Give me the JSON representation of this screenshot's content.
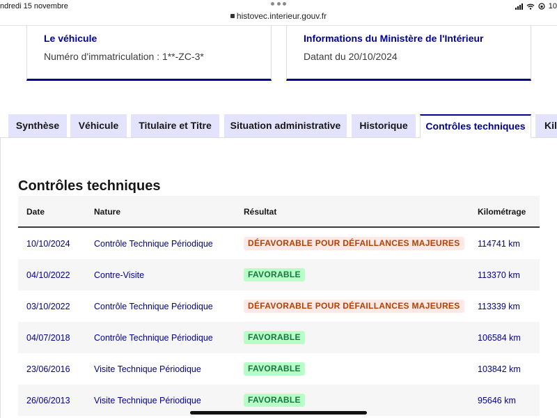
{
  "status_bar": {
    "date": "ndredi 15 novembre",
    "battery": "10"
  },
  "browser": {
    "url": "histovec.interieur.gouv.fr"
  },
  "cards": {
    "vehicle": {
      "title": "Le véhicule",
      "subtitle": "Numéro d'immatriculation : 1**-ZC-3*"
    },
    "ministry": {
      "title": "Informations du Ministère de l'Intérieur",
      "subtitle": "Datant du 20/10/2024"
    }
  },
  "tabs": [
    {
      "label": "Synthèse",
      "active": false
    },
    {
      "label": "Véhicule",
      "active": false
    },
    {
      "label": "Titulaire et Titre",
      "active": false
    },
    {
      "label": "Situation administrative",
      "active": false
    },
    {
      "label": "Historique",
      "active": false
    },
    {
      "label": "Contrôles techniques",
      "active": true
    },
    {
      "label": "Kil",
      "active": false
    }
  ],
  "section": {
    "title": "Contrôles techniques"
  },
  "table": {
    "headers": {
      "date": "Date",
      "nature": "Nature",
      "result": "Résultat",
      "mileage": "Kilométrage"
    },
    "rows": [
      {
        "date": "10/10/2024",
        "nature": "Contrôle Technique Périodique",
        "result": "DÉFAVORABLE POUR DÉFAILLANCES MAJEURES",
        "result_status": "fail",
        "mileage": "114741 km"
      },
      {
        "date": "04/10/2022",
        "nature": "Contre-Visite",
        "result": "FAVORABLE",
        "result_status": "ok",
        "mileage": "113370 km"
      },
      {
        "date": "03/10/2022",
        "nature": "Contrôle Technique Périodique",
        "result": "DÉFAVORABLE POUR DÉFAILLANCES MAJEURES",
        "result_status": "fail",
        "mileage": "113339 km"
      },
      {
        "date": "04/07/2018",
        "nature": "Contrôle Technique Périodique",
        "result": "FAVORABLE",
        "result_status": "ok",
        "mileage": "106584 km"
      },
      {
        "date": "23/06/2016",
        "nature": "Visite Technique Périodique",
        "result": "FAVORABLE",
        "result_status": "ok",
        "mileage": "103842 km"
      },
      {
        "date": "26/06/2013",
        "nature": "Visite Technique Périodique",
        "result": "FAVORABLE",
        "result_status": "ok",
        "mileage": "95646 km"
      }
    ]
  },
  "colors": {
    "primary_blue": "#000091",
    "tab_background": "#e3e3fd",
    "fail_text": "#b34000",
    "fail_background": "#ffe9e6",
    "ok_text": "#18753c",
    "ok_background": "#b8fec9"
  },
  "icons": {
    "lock": "lock-icon",
    "signal": "cellular-signal-icon",
    "wifi": "wifi-icon",
    "battery": "battery-icon"
  }
}
